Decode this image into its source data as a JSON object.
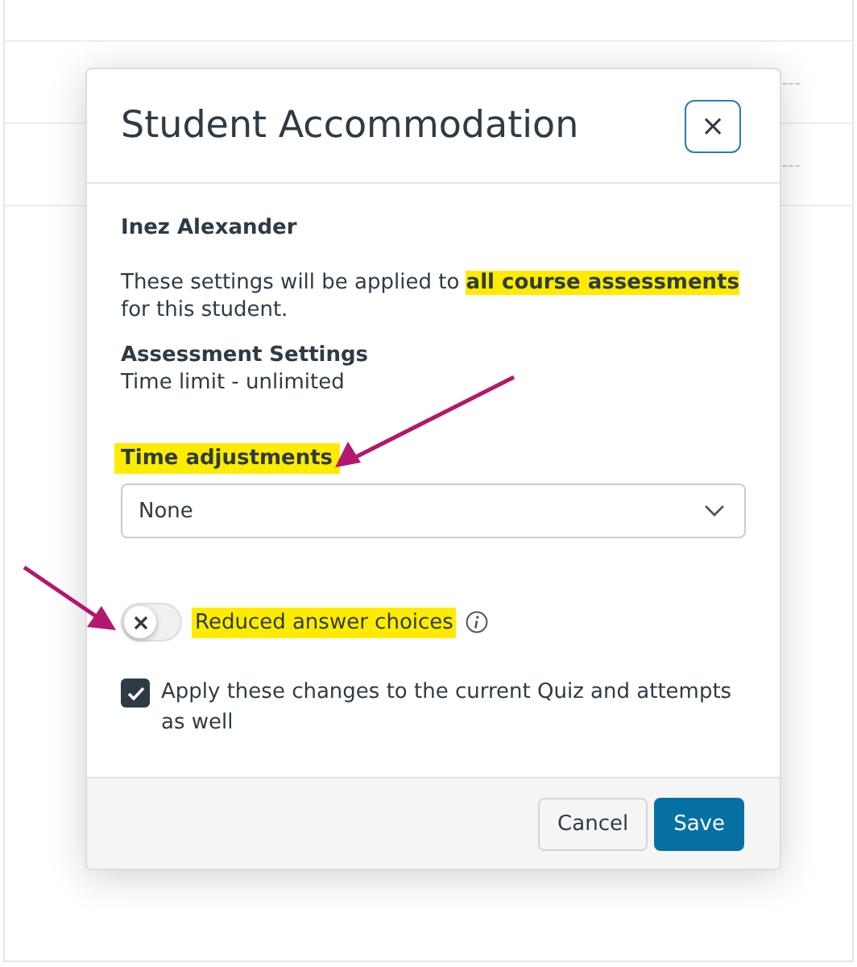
{
  "background_table": {
    "rows": [
      {
        "column_4": "---"
      },
      {
        "column_4": "---"
      }
    ]
  },
  "modal": {
    "title": "Student Accommodation",
    "close_label": "×",
    "student_name": "Inez Alexander",
    "description": "These settings will be applied to **all course assessments** for this student.",
    "settings_heading": "Assessment Settings",
    "settings_value": "Time limit - unlimited",
    "time_adjustments": {
      "label": "Time adjustments",
      "value": "None"
    },
    "reduced_answer_choices": {
      "label": "Reduced answer choices",
      "on": false
    },
    "apply_to_current": {
      "label": "Apply these changes to the current Quiz and attempts as well",
      "checked": true
    },
    "buttons": [
      {
        "label": "Cancel",
        "kind": "secondary"
      },
      {
        "label": "Save",
        "kind": "primary"
      }
    ]
  }
}
